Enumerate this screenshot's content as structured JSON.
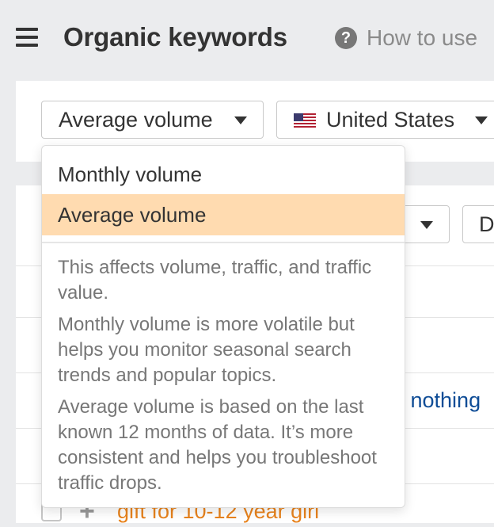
{
  "header": {
    "menu_icon": "hamburger-icon",
    "title": "Organic keywords",
    "help_icon": "question-circle-icon",
    "help_icon_glyph": "?",
    "how_to_use": "How to use"
  },
  "filters": {
    "volume_select": {
      "value": "Average volume",
      "icon": "caret-down-icon"
    },
    "country_select": {
      "value": "United States",
      "flag_icon": "us-flag-icon",
      "icon": "caret-down-icon"
    },
    "row2_partial_b": "D"
  },
  "volume_menu": {
    "options": [
      {
        "label": "Monthly volume",
        "selected": false
      },
      {
        "label": "Average volume",
        "selected": true
      }
    ],
    "descriptions": [
      "This affects volume, traffic, and traffic value.",
      "Monthly volume is more volatile but helps you monitor seasonal search trends and popular topics.",
      "Average volume is based on the last known 12 months of data. It’s more consistent and helps you troubleshoot traffic drops."
    ],
    "selected_color": "#ffdbb0"
  },
  "table": {
    "partial_link_text": "ts nothing",
    "rows": [
      {
        "keyword": "gift for 10-12 year girl",
        "add_icon": "plus-icon",
        "checked": false
      }
    ],
    "link_color": "#0e4c96",
    "keyword_color": "#e8831d"
  }
}
